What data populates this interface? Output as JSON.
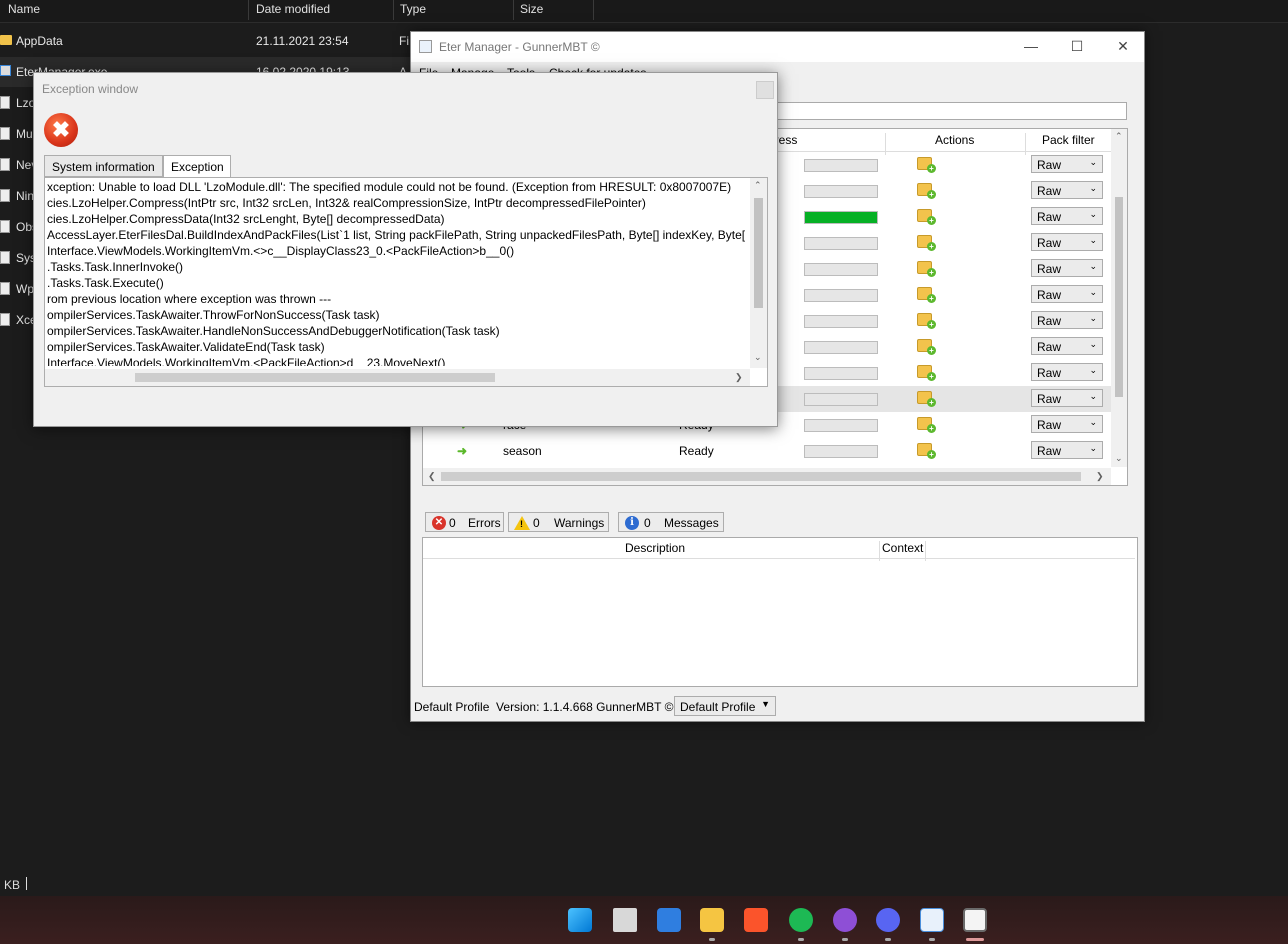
{
  "explorer": {
    "columns": {
      "name": "Name",
      "date": "Date modified",
      "type": "Type",
      "size": "Size"
    },
    "rows": [
      {
        "name": "AppData",
        "date": "21.11.2021 23:54",
        "type": "Fi",
        "kind": "folder"
      },
      {
        "name": "EterManager.exe",
        "date": "16.02.2020 19:13",
        "type": "A",
        "kind": "exe"
      },
      {
        "name": "Lzo",
        "kind": "file"
      },
      {
        "name": "Mu",
        "kind": "file"
      },
      {
        "name": "Nev",
        "kind": "file"
      },
      {
        "name": "Nin",
        "kind": "file"
      },
      {
        "name": "Obs",
        "kind": "file"
      },
      {
        "name": "Syst",
        "kind": "file"
      },
      {
        "name": "Wp",
        "kind": "file"
      },
      {
        "name": "Xce",
        "kind": "file"
      }
    ],
    "status": "KB"
  },
  "eter": {
    "title": "Eter Manager - GunnerMBT ©",
    "menu": [
      "File",
      "Manage",
      "Tools",
      "Check for updates"
    ],
    "grid_headers": {
      "progress": "gress",
      "actions": "Actions",
      "filter": "Pack filter"
    },
    "rows": [
      {
        "name": "",
        "state": "",
        "progress": 0,
        "filter": "Raw"
      },
      {
        "name": "",
        "state": "",
        "progress": 0,
        "filter": "Raw"
      },
      {
        "name": "",
        "state": "",
        "progress": 1,
        "filter": "Raw"
      },
      {
        "name": "",
        "state": "",
        "progress": 0,
        "filter": "Raw"
      },
      {
        "name": "",
        "state": "",
        "progress": 0,
        "filter": "Raw"
      },
      {
        "name": "",
        "state": "",
        "progress": 0,
        "filter": "Raw"
      },
      {
        "name": "",
        "state": "",
        "progress": 0,
        "filter": "Raw"
      },
      {
        "name": "",
        "state": "",
        "progress": 0,
        "filter": "Raw"
      },
      {
        "name": "",
        "state": "",
        "progress": 0,
        "filter": "Raw"
      },
      {
        "name": "",
        "state": "",
        "progress": 0,
        "filter": "Raw",
        "highlight": true
      },
      {
        "name": "race",
        "state": "Ready",
        "progress": 0,
        "filter": "Raw"
      },
      {
        "name": "season",
        "state": "Ready",
        "progress": 0,
        "filter": "Raw"
      }
    ],
    "errors": {
      "count": "0",
      "label": "Errors"
    },
    "warnings": {
      "count": "0",
      "label": "Warnings"
    },
    "messages": {
      "count": "0",
      "label": "Messages"
    },
    "msg_headers": {
      "description": "Description",
      "context": "Context"
    },
    "footer": {
      "profile": "Default Profile",
      "version": "Version: 1.1.4.668 GunnerMBT ©",
      "select": "Default Profile"
    }
  },
  "exception": {
    "title": "Exception window",
    "tabs": [
      "System information",
      "Exception"
    ],
    "lines": [
      "xception: Unable to load DLL 'LzoModule.dll': The specified module could not be found. (Exception from HRESULT: 0x8007007E)",
      "cies.LzoHelper.Compress(IntPtr src, Int32 srcLen, Int32& realCompressionSize, IntPtr decompressedFilePointer)",
      "cies.LzoHelper.CompressData(Int32 srcLenght, Byte[] decompressedData)",
      "AccessLayer.EterFilesDal.BuildIndexAndPackFiles(List`1 list, String packFilePath, String unpackedFilesPath, Byte[] indexKey, Byte[] pack",
      "Interface.ViewModels.WorkingItemVm.<>c__DisplayClass23_0.<PackFileAction>b__0()",
      ".Tasks.Task.InnerInvoke()",
      ".Tasks.Task.Execute()",
      "rom previous location where exception was thrown ---",
      "ompilerServices.TaskAwaiter.ThrowForNonSuccess(Task task)",
      "ompilerServices.TaskAwaiter.HandleNonSuccessAndDebuggerNotification(Task task)",
      "ompilerServices.TaskAwaiter.ValidateEnd(Task task)",
      "Interface.ViewModels.WorkingItemVm.<PackFileAction>d__23.MoveNext()"
    ]
  },
  "colors": {
    "progress_fill": "#06b025",
    "accent": "#0078d4"
  }
}
